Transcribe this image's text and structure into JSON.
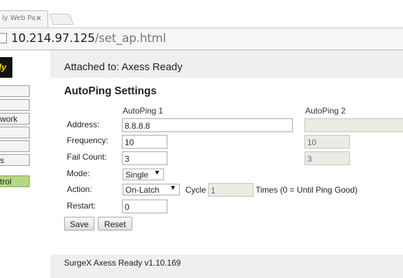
{
  "browser": {
    "tab_title": "ly Web Pa",
    "tab_close": "×",
    "url_host": "10.214.97.125",
    "url_path": "/set_ap.html"
  },
  "sidebar": {
    "logo_text": "dy",
    "items": [
      {
        "label": ""
      },
      {
        "label": ""
      },
      {
        "label": "work"
      },
      {
        "label": ""
      },
      {
        "label": ""
      },
      {
        "label": "s"
      },
      {
        "label": "trol"
      }
    ]
  },
  "header": {
    "attached": "Attached to: Axess Ready"
  },
  "form": {
    "title": "AutoPing Settings",
    "col1": "AutoPing 1",
    "col2": "AutoPing 2",
    "labels": {
      "address": "Address:",
      "frequency": "Frequency:",
      "fail_count": "Fail Count:",
      "mode": "Mode:",
      "action": "Action:",
      "restart": "Restart:"
    },
    "ap1": {
      "address": "8.8.8.8",
      "frequency": "10",
      "fail_count": "3",
      "mode": "Single",
      "action": "On-Latch",
      "cycle": "1",
      "restart": "0"
    },
    "ap2": {
      "address": "",
      "frequency": "10",
      "fail_count": "3"
    },
    "cycle_label": "Cycle",
    "times_label": "Times (0 = Until Ping Good)",
    "save_label": "Save",
    "reset_label": "Reset"
  },
  "footer": {
    "version": "SurgeX Axess Ready v1.10.169"
  }
}
